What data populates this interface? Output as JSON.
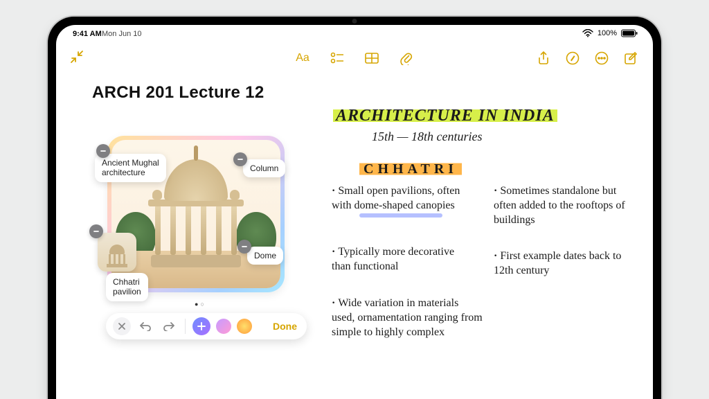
{
  "status": {
    "time": "9:41 AM",
    "date": "Mon Jun 10",
    "battery": "100%"
  },
  "toolbar": {
    "text_style": "Aa",
    "done": "Done"
  },
  "note": {
    "title": "ARCH 201 Lecture 12",
    "heading": "ARCHITECTURE IN INDIA",
    "subheading": "15th — 18th centuries",
    "section": "CHHATRI",
    "bullets_left": [
      "Small open pavilions, often with dome-shaped canopies",
      "Typically more decorative than functional",
      "Wide variation in materials used, ornamentation ranging from simple to highly complex"
    ],
    "bullets_right": [
      "Sometimes standalone but often added to the rooftops of buildings",
      "First example dates back to 12th century"
    ]
  },
  "image_tags": {
    "top_left": "Ancient Mughal\narchitecture",
    "top_right": "Column",
    "bottom_left": "Chhatri\npavilion",
    "bottom_right": "Dome"
  },
  "colors": {
    "accent": "#d6a500",
    "highlight_green": "#d7ef4a",
    "highlight_orange": "#ffb64a",
    "underline_blue": "#7e8cff"
  }
}
